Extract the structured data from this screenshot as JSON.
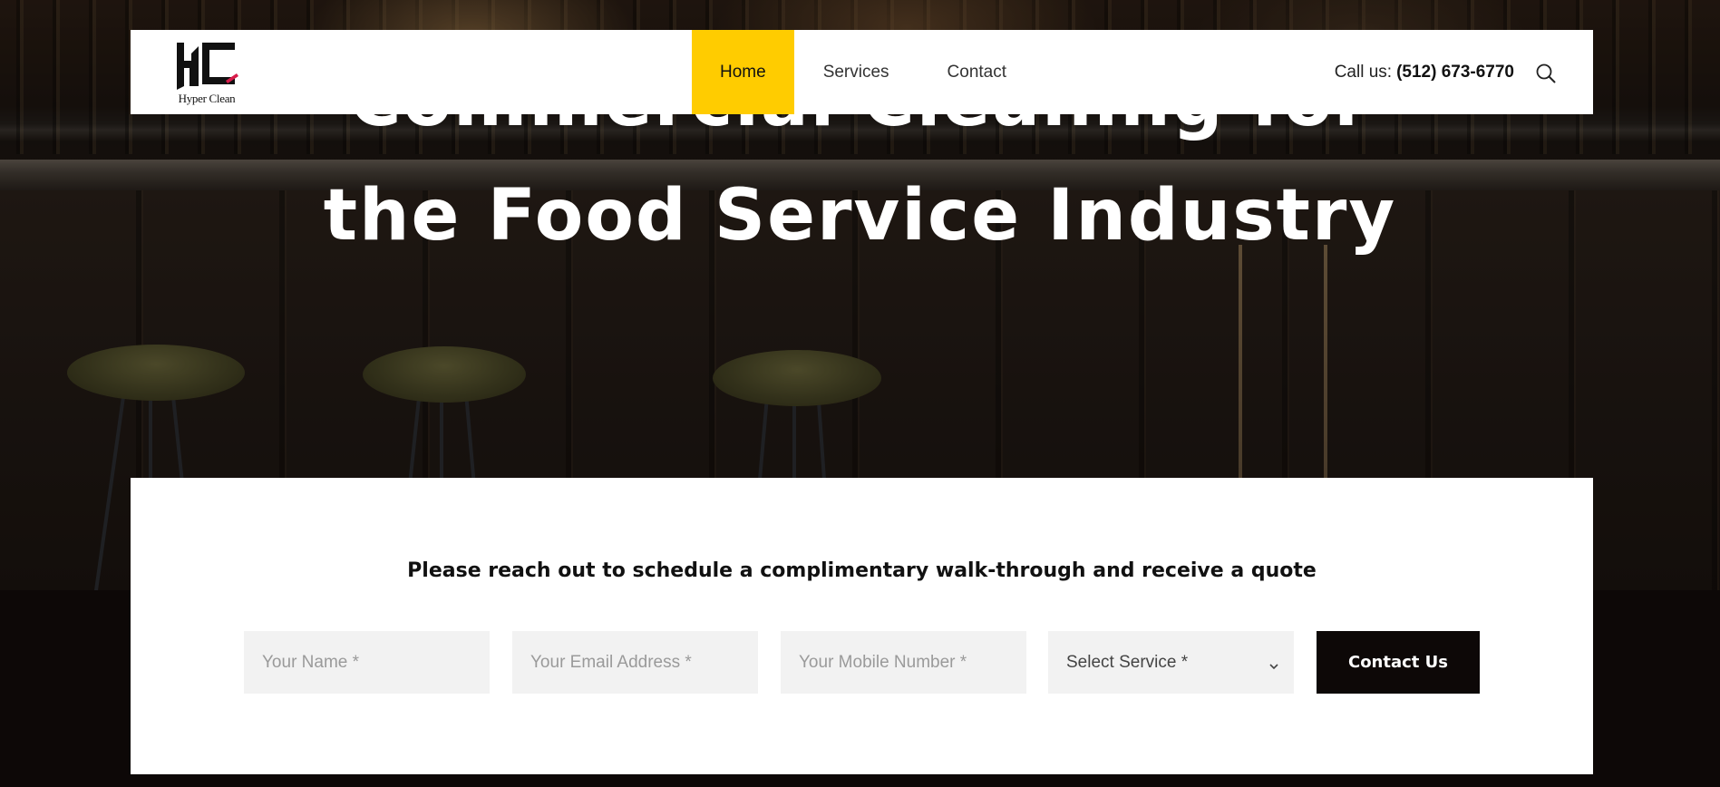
{
  "hero": {
    "title_line1": "Commercial Cleaning for",
    "title_line2": "the Food Service Industry"
  },
  "header": {
    "logo_text": "Hyper Clean",
    "nav": [
      {
        "label": "Home",
        "active": true
      },
      {
        "label": "Services",
        "active": false
      },
      {
        "label": "Contact",
        "active": false
      }
    ],
    "call_label": "Call us:",
    "phone": "(512) 673-6770",
    "search_icon": "search-icon"
  },
  "form": {
    "heading": "Please reach out to schedule a complimentary walk-through and receive a quote",
    "name_placeholder": "Your Name *",
    "email_placeholder": "Your Email Address *",
    "mobile_placeholder": "Your Mobile Number *",
    "service_selected": "Select Service *",
    "submit_label": "Contact Us"
  },
  "colors": {
    "accent": "#ffcc00",
    "dark": "#0d0807",
    "field_bg": "#f2f2f2"
  }
}
